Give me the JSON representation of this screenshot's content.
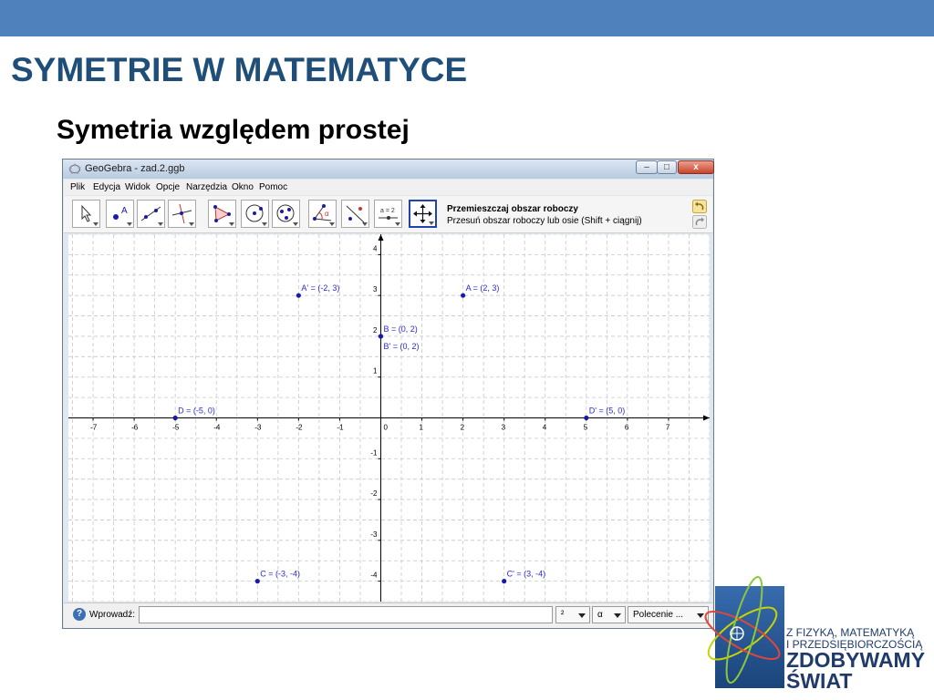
{
  "slide": {
    "title": "SYMETRIE W MATEMATYCE",
    "subtitle": "Symetria względem prostej"
  },
  "window": {
    "title": "GeoGebra - zad.2.ggb",
    "controls": {
      "minimize": "–",
      "maximize": "□",
      "close": "x"
    }
  },
  "menu": [
    "Plik",
    "Edycja",
    "Widok",
    "Opcje",
    "Narzędzia",
    "Okno",
    "Pomoc"
  ],
  "toolbar": {
    "tools": [
      "move-tool",
      "point-tool",
      "line-tool",
      "perpendicular-line-tool",
      "polygon-tool",
      "circle-tool",
      "circle-three-points-tool",
      "angle-tool",
      "reflect-tool",
      "slider-tool",
      "move-graphics-tool"
    ],
    "slider_label": "a = 2",
    "active_title": "Przemieszczaj obszar roboczy",
    "active_help": "Przesuń obszar roboczy lub osie (Shift + ciągnij)"
  },
  "graph": {
    "xlim": [
      -7.6,
      8
    ],
    "ylim": [
      -4.5,
      4.5
    ],
    "x_ticks": [
      -7,
      -6,
      -5,
      -4,
      -3,
      -2,
      -1,
      0,
      1,
      2,
      3,
      4,
      5,
      6,
      7
    ],
    "y_ticks": [
      -4,
      -3,
      -2,
      -1,
      0,
      1,
      2,
      3,
      4
    ],
    "grid": true,
    "points": [
      {
        "label": "A = (2, 3)",
        "x": 2,
        "y": 3
      },
      {
        "label": "A' = (-2, 3)",
        "x": -2,
        "y": 3
      },
      {
        "label": "B = (0, 2)",
        "x": 0,
        "y": 2
      },
      {
        "label": "B' = (0, 2)",
        "x": 0,
        "y": 2
      },
      {
        "label": "D = (-5, 0)",
        "x": -5,
        "y": 0
      },
      {
        "label": "D' = (5, 0)",
        "x": 5,
        "y": 0
      },
      {
        "label": "C = (-3, -4)",
        "x": -3,
        "y": -4
      },
      {
        "label": "C' = (3, -4)",
        "x": 3,
        "y": -4
      }
    ],
    "point_color": "#1a1aa6",
    "label_color": "#2a2ad0"
  },
  "inputbar": {
    "label": "Wprowadź:",
    "value": "",
    "combo1": "²",
    "combo2": "α",
    "combo3": "Polecenie ..."
  },
  "logo": {
    "line1": "Z FIZYKĄ, MATEMATYKĄ",
    "line2": "I PRZEDSIĘBIORCZOŚCIĄ",
    "line3": "ZDOBYWAMY",
    "line4": "ŚWIAT"
  }
}
